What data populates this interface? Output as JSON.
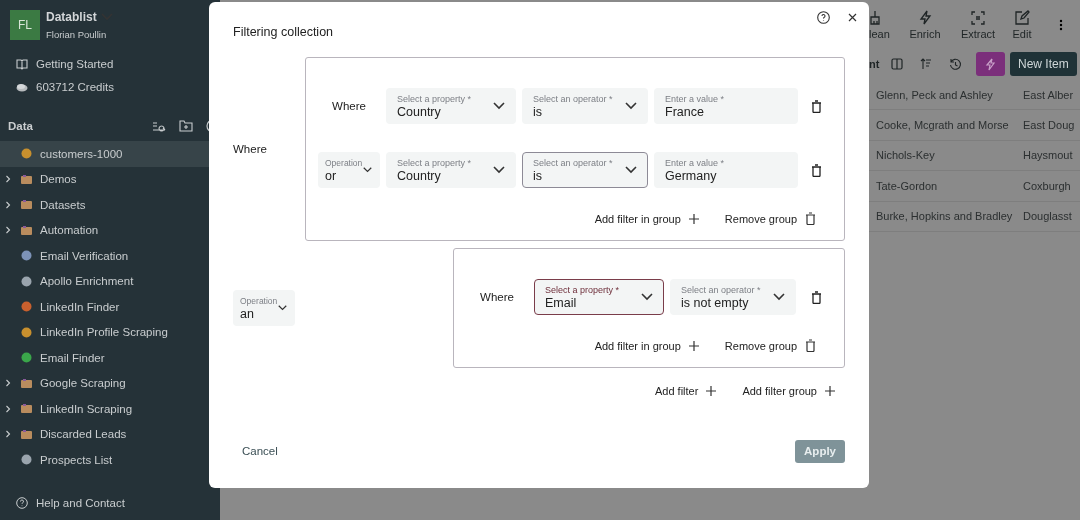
{
  "sidebar": {
    "workspace": {
      "initials": "FL",
      "name": "Datablist",
      "user": "Florian Poullin"
    },
    "links": [
      {
        "kind": "book",
        "label": "Getting Started"
      },
      {
        "kind": "coins",
        "label": "603712 Credits"
      }
    ],
    "section_title": "Data",
    "items": [
      {
        "kind": "collection",
        "label": "customers-1000",
        "selected": true
      },
      {
        "kind": "folder",
        "label": "Demos",
        "selected": false
      },
      {
        "kind": "folder",
        "label": "Datasets",
        "selected": false
      },
      {
        "kind": "folder",
        "label": "Automation",
        "selected": false
      },
      {
        "kind": "collection",
        "label": "Email Verification",
        "selected": false
      },
      {
        "kind": "collection",
        "label": "Apollo Enrichment",
        "selected": false
      },
      {
        "kind": "collection",
        "label": "LinkedIn Finder",
        "selected": false
      },
      {
        "kind": "collection",
        "label": "LinkedIn Profile Scraping",
        "selected": false
      },
      {
        "kind": "collection",
        "label": "Email Finder",
        "selected": false
      },
      {
        "kind": "folder",
        "label": "Google Scraping",
        "selected": false
      },
      {
        "kind": "folder",
        "label": "LinkedIn Scraping",
        "selected": false
      },
      {
        "kind": "folder",
        "label": "Discarded Leads",
        "selected": false
      },
      {
        "kind": "collection",
        "label": "Prospects List",
        "selected": false
      }
    ],
    "footer_link": "Help and Contact"
  },
  "toolbar": {
    "actions": [
      {
        "kind": "clean",
        "label": "lean"
      },
      {
        "kind": "enrich",
        "label": "Enrich"
      },
      {
        "kind": "extract",
        "label": "Extract"
      },
      {
        "kind": "edit",
        "label": "Edit"
      }
    ],
    "filter_label": "nt",
    "new_item": "New Item"
  },
  "table": {
    "rows": [
      [
        "Glenn, Peck and Ashley",
        "East Alber"
      ],
      [
        "Cooke, Mcgrath and Morse",
        "East Doug"
      ],
      [
        "Nichols-Key",
        "Haysmout"
      ],
      [
        "Tate-Gordon",
        "Coxburgh"
      ],
      [
        "Burke, Hopkins and Bradley",
        "Douglasst"
      ]
    ]
  },
  "dialog": {
    "title": "Filtering collection",
    "groups": [
      {
        "connector": {
          "kind": "label",
          "text": "Where"
        },
        "conditions": [
          {
            "connector": {
              "kind": "label",
              "text": "Where"
            },
            "fields": [
              {
                "kind": "select",
                "label": "Select a property *",
                "value": "Country",
                "focused": false,
                "hovered": false
              },
              {
                "kind": "select",
                "label": "Select an operator *",
                "value": "is",
                "focused": false,
                "hovered": false
              },
              {
                "kind": "input",
                "label": "Enter a value *",
                "value": "France",
                "focused": false,
                "hovered": false
              }
            ]
          },
          {
            "connector": {
              "kind": "select",
              "label": "Operation",
              "value": "or"
            },
            "fields": [
              {
                "kind": "select",
                "label": "Select a property *",
                "value": "Country",
                "focused": false,
                "hovered": false
              },
              {
                "kind": "select",
                "label": "Select an operator *",
                "value": "is",
                "focused": false,
                "hovered": true
              },
              {
                "kind": "input",
                "label": "Enter a value *",
                "value": "Germany",
                "focused": false,
                "hovered": false
              }
            ]
          }
        ],
        "add_label": "Add filter in group",
        "remove_label": "Remove group"
      },
      {
        "connector": {
          "kind": "select",
          "label": "Operation",
          "value": "an"
        },
        "conditions": [
          {
            "connector": {
              "kind": "label",
              "text": "Where"
            },
            "fields": [
              {
                "kind": "select",
                "label": "Select a property *",
                "value": "Email",
                "focused": true,
                "hovered": false
              },
              {
                "kind": "select",
                "label": "Select an operator *",
                "value": "is not empty",
                "focused": false,
                "hovered": false
              }
            ]
          }
        ],
        "add_label": "Add filter in group",
        "remove_label": "Remove group"
      }
    ],
    "add_filter": "Add filter",
    "add_group": "Add filter group",
    "cancel": "Cancel",
    "apply": {
      "label": "Apply",
      "disabled": true
    }
  }
}
